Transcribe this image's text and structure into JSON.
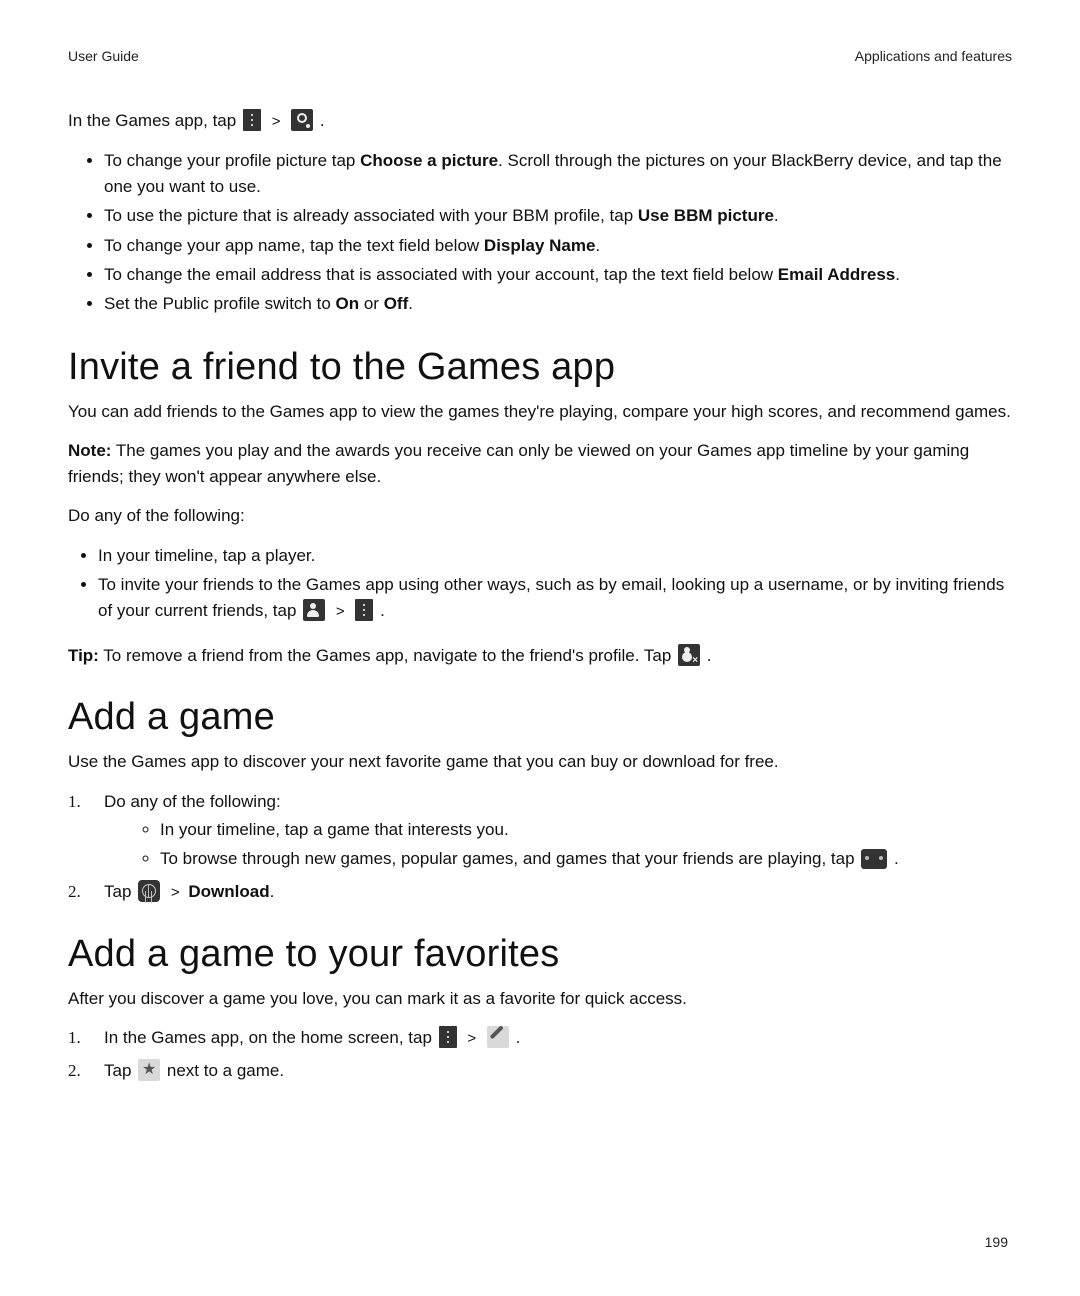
{
  "header": {
    "left": "User Guide",
    "right": "Applications and features"
  },
  "intro_sentence": "In the Games app, tap",
  "sep": ">",
  "bullets_profile": {
    "b1a": "To change your profile picture tap ",
    "b1bold": "Choose a picture",
    "b1b": ". Scroll through the pictures on your BlackBerry device, and tap the one you want to use.",
    "b2a": "To use the picture that is already associated with your BBM profile, tap ",
    "b2bold": "Use BBM picture",
    "b2b": ".",
    "b3a": "To change your app name, tap the text field below ",
    "b3bold": "Display Name",
    "b3b": ".",
    "b4a": "To change the email address that is associated with your account, tap the text field below ",
    "b4bold": "Email Address",
    "b4b": ".",
    "b5a": "Set the Public profile switch to ",
    "b5bold1": "On",
    "b5mid": " or ",
    "b5bold2": "Off",
    "b5b": "."
  },
  "invite": {
    "heading": "Invite a friend to the Games app",
    "p1": "You can add friends to the Games app to view the games they're playing, compare your high scores, and recommend games.",
    "note_label": "Note:",
    "note_body": " The games you play and the awards you receive can only be viewed on your Games app timeline by your gaming friends; they won't appear anywhere else.",
    "p3": "Do any of the following:",
    "bl1": "In your timeline, tap a player.",
    "bl2a": "To invite your friends to the Games app using other ways, such as by email, looking up a username, or by inviting friends of your current friends, tap",
    "tip_label": "Tip:",
    "tip_body": " To remove a friend from the Games app, navigate to the friend's profile. Tap"
  },
  "addgame": {
    "heading": "Add a game",
    "p1": "Use the Games app to discover your next favorite game that you can buy or download for free.",
    "ol1": "Do any of the following:",
    "ol1_b1": "In your timeline, tap a game that interests you.",
    "ol1_b2": "To browse through new games, popular games, and games that your friends are playing, tap",
    "ol2a": "Tap",
    "ol2bold": "Download",
    "period": "."
  },
  "favorites": {
    "heading": "Add a game to your favorites",
    "p1": "After you discover a game you love, you can mark it as a favorite for quick access.",
    "ol1a": "In the Games app, on the home screen, tap",
    "ol2a": "Tap",
    "ol2b": "next to a game."
  },
  "pagenum": "199"
}
